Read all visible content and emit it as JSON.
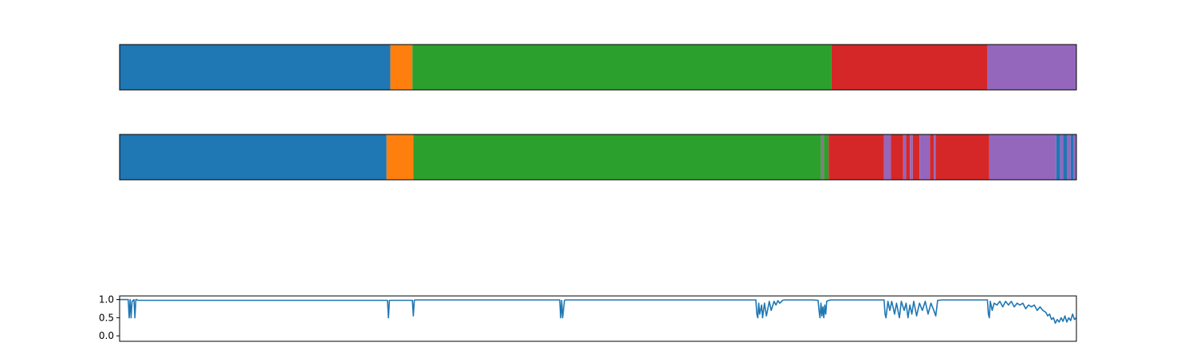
{
  "colors": {
    "blue": "#1f77b4",
    "orange": "#ff7f0e",
    "green": "#2ca02c",
    "red": "#d62728",
    "purple": "#9467bd",
    "gray": "#7f7f7f",
    "line": "#1f77b4",
    "axis": "#000000"
  },
  "chart_data": [
    {
      "type": "bar",
      "name": "",
      "xlim": [
        0,
        1000
      ],
      "segments": [
        {
          "start": 0,
          "end": 283,
          "color": "blue"
        },
        {
          "start": 283,
          "end": 306,
          "color": "orange"
        },
        {
          "start": 306,
          "end": 744,
          "color": "green"
        },
        {
          "start": 744,
          "end": 907,
          "color": "red"
        },
        {
          "start": 907,
          "end": 1000,
          "color": "purple"
        }
      ],
      "grid": false
    },
    {
      "type": "bar",
      "name": "",
      "xlim": [
        0,
        1000
      ],
      "segments": [
        {
          "start": 0,
          "end": 279,
          "color": "blue"
        },
        {
          "start": 279,
          "end": 307,
          "color": "orange"
        },
        {
          "start": 307,
          "end": 733,
          "color": "green"
        },
        {
          "start": 733,
          "end": 736,
          "color": "gray"
        },
        {
          "start": 736,
          "end": 741,
          "color": "green"
        },
        {
          "start": 741,
          "end": 799,
          "color": "red"
        },
        {
          "start": 799,
          "end": 806,
          "color": "purple"
        },
        {
          "start": 806,
          "end": 819,
          "color": "red"
        },
        {
          "start": 819,
          "end": 822,
          "color": "purple"
        },
        {
          "start": 822,
          "end": 826,
          "color": "red"
        },
        {
          "start": 826,
          "end": 829,
          "color": "purple"
        },
        {
          "start": 829,
          "end": 836,
          "color": "red"
        },
        {
          "start": 836,
          "end": 847,
          "color": "purple"
        },
        {
          "start": 847,
          "end": 851,
          "color": "red"
        },
        {
          "start": 851,
          "end": 853,
          "color": "purple"
        },
        {
          "start": 853,
          "end": 909,
          "color": "red"
        },
        {
          "start": 909,
          "end": 979,
          "color": "purple"
        },
        {
          "start": 979,
          "end": 983,
          "color": "blue"
        },
        {
          "start": 983,
          "end": 986,
          "color": "purple"
        },
        {
          "start": 986,
          "end": 990,
          "color": "blue"
        },
        {
          "start": 990,
          "end": 994,
          "color": "purple"
        },
        {
          "start": 994,
          "end": 997,
          "color": "blue"
        },
        {
          "start": 997,
          "end": 1000,
          "color": "purple"
        }
      ],
      "grid": false
    },
    {
      "type": "line",
      "name": "",
      "xlim": [
        0,
        1000
      ],
      "ylim": [
        -0.15,
        1.1
      ],
      "yticks": [
        0.0,
        0.5,
        1.0
      ],
      "ytick_labels": [
        "0.0",
        "0.5",
        "1.0"
      ],
      "x": [
        0,
        9,
        10,
        11,
        12,
        13,
        15,
        16,
        17,
        18,
        19,
        280,
        281,
        282,
        283,
        300,
        306,
        307,
        308,
        309,
        460,
        461,
        462,
        463,
        465,
        466,
        467,
        468,
        469,
        480,
        600,
        605,
        610,
        665,
        666,
        667,
        668,
        669,
        671,
        672,
        674,
        676,
        679,
        681,
        684,
        686,
        688,
        690,
        693,
        695,
        700,
        725,
        730,
        731,
        732,
        733,
        734,
        735,
        736,
        737,
        738,
        739,
        741,
        744,
        747,
        750,
        790,
        799,
        800,
        801,
        803,
        805,
        807,
        810,
        812,
        815,
        817,
        820,
        822,
        824,
        826,
        828,
        830,
        833,
        836,
        839,
        842,
        845,
        848,
        851,
        853,
        855,
        860,
        890,
        905,
        906,
        907,
        908,
        909,
        910,
        912,
        914,
        917,
        920,
        923,
        926,
        929,
        932,
        935,
        938,
        941,
        944,
        947,
        950,
        953,
        956,
        959,
        962,
        965,
        968,
        970,
        972,
        974,
        976,
        978,
        980,
        982,
        984,
        986,
        988,
        990,
        992,
        994,
        996,
        998,
        1000
      ],
      "y": [
        1.0,
        1.0,
        0.5,
        1.0,
        0.5,
        0.95,
        1.0,
        0.5,
        1.0,
        1.0,
        0.98,
        0.98,
        0.5,
        0.98,
        0.98,
        0.98,
        0.98,
        0.55,
        0.98,
        0.99,
        0.99,
        0.5,
        0.98,
        0.5,
        0.98,
        0.99,
        0.99,
        0.99,
        0.99,
        0.99,
        0.99,
        0.99,
        0.99,
        0.99,
        0.6,
        0.5,
        0.9,
        0.6,
        0.85,
        0.5,
        0.9,
        0.55,
        0.95,
        0.7,
        0.95,
        0.85,
        0.97,
        0.9,
        0.98,
        0.99,
        0.99,
        0.99,
        0.98,
        0.7,
        0.5,
        0.9,
        0.55,
        0.8,
        0.5,
        0.85,
        0.6,
        0.95,
        0.98,
        0.99,
        0.99,
        0.99,
        0.99,
        0.99,
        0.6,
        0.5,
        0.95,
        0.7,
        0.95,
        0.6,
        0.9,
        0.5,
        0.95,
        0.7,
        0.9,
        0.5,
        0.85,
        0.6,
        0.95,
        0.55,
        0.9,
        0.7,
        0.95,
        0.6,
        0.9,
        0.7,
        0.55,
        0.98,
        0.99,
        0.99,
        0.99,
        0.99,
        0.99,
        0.6,
        0.5,
        0.95,
        0.7,
        0.9,
        0.85,
        0.95,
        0.8,
        0.95,
        0.85,
        0.95,
        0.8,
        0.9,
        0.85,
        0.9,
        0.75,
        0.85,
        0.8,
        0.85,
        0.7,
        0.8,
        0.7,
        0.65,
        0.55,
        0.6,
        0.45,
        0.5,
        0.35,
        0.45,
        0.38,
        0.5,
        0.4,
        0.55,
        0.38,
        0.5,
        0.42,
        0.6,
        0.45,
        0.5
      ],
      "grid": false
    }
  ]
}
